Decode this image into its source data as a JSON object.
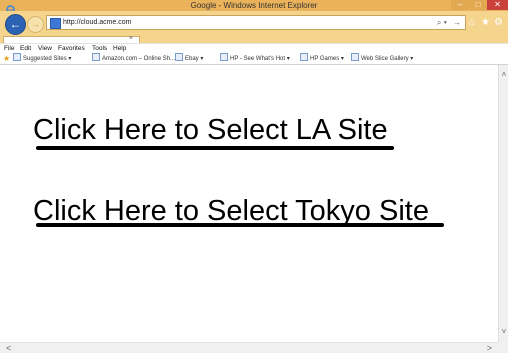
{
  "window": {
    "title": "Google - Windows Internet Explorer",
    "controls": {
      "minimize": "–",
      "maximize": "□",
      "close": "✕"
    }
  },
  "navigation": {
    "back_icon": "arrow-left-icon",
    "forward_icon": "arrow-right-icon",
    "address": "http://cloud.acme.com",
    "search_symbol": "⌕ ▾",
    "go_symbol": "→",
    "home_icon": "⌂",
    "favorites_icon": "★",
    "tools_icon": "⚙"
  },
  "tabs": [
    {
      "label": "",
      "close": "×"
    }
  ],
  "menu": {
    "items": [
      "File",
      "Edit",
      "View",
      "Favorites",
      "Tools",
      "Help"
    ]
  },
  "favorites_bar": {
    "items": [
      "Suggested Sites ▾",
      "Amazon.com – Online Sh...",
      "Ebay ▾",
      "HP - See What's Hot ▾",
      "HP Games ▾",
      "Web Slice Gallery ▾"
    ]
  },
  "content": {
    "la_link": "Click Here to Select LA Site",
    "tokyo_link": "Click Here to Select Tokyo Site"
  },
  "scrollbars": {
    "up": "˄",
    "down": "˅",
    "left": "<",
    "right": ">"
  },
  "colors": {
    "chrome": "#f5d48e",
    "titlebar": "#eab25a",
    "back_button": "#2b62b3",
    "close_button": "#c9413a"
  }
}
